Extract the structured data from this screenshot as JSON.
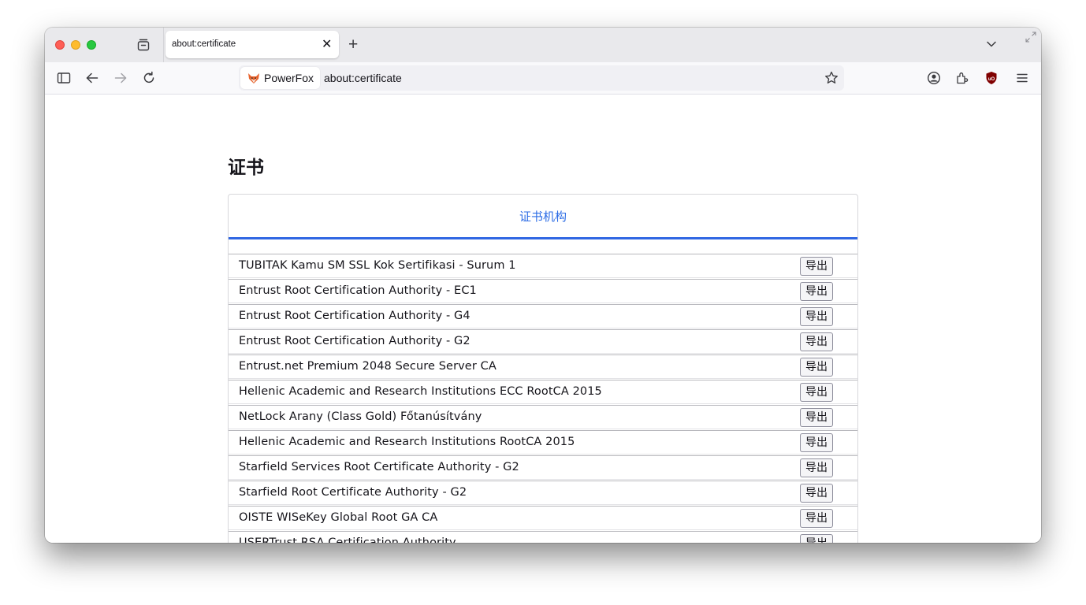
{
  "browser": {
    "tab_title": "about:certificate",
    "tab_close_glyph": "✕",
    "new_tab_glyph": "+",
    "identity_label": "PowerFox",
    "url": "about:certificate"
  },
  "page": {
    "title": "证书",
    "section_tab": "证书机构",
    "export_label": "导出",
    "rows": [
      "TUBITAK Kamu SM SSL Kok Sertifikasi - Surum 1",
      "Entrust Root Certification Authority - EC1",
      "Entrust Root Certification Authority - G4",
      "Entrust Root Certification Authority - G2",
      "Entrust.net Premium 2048 Secure Server CA",
      "Hellenic Academic and Research Institutions ECC RootCA 2015",
      "NetLock Arany (Class Gold) Főtanúsítvány",
      "Hellenic Academic and Research Institutions RootCA 2015",
      "Starfield Services Root Certificate Authority - G2",
      "Starfield Root Certificate Authority - G2",
      "OISTE WISeKey Global Root GA CA",
      "USERTrust RSA Certification Authority"
    ]
  },
  "icons": {
    "close": "close-icon",
    "minimize": "minimize-icon",
    "zoom": "zoom-icon",
    "tab_overview": "tab-overview-icon",
    "list_tabs": "chevron-down-icon",
    "sidebar": "sidebar-icon",
    "back": "back-arrow-icon",
    "forward": "forward-arrow-icon",
    "reload": "reload-icon",
    "fox": "fox-logo-icon",
    "bookmark": "star-icon",
    "account": "account-icon",
    "extensions": "extensions-icon",
    "ublock": "ublock-shield-icon",
    "menu": "hamburger-menu-icon"
  },
  "colors": {
    "accent": "#3067e3",
    "tab_label": "#2c6ce5",
    "ublock": "#800000"
  }
}
